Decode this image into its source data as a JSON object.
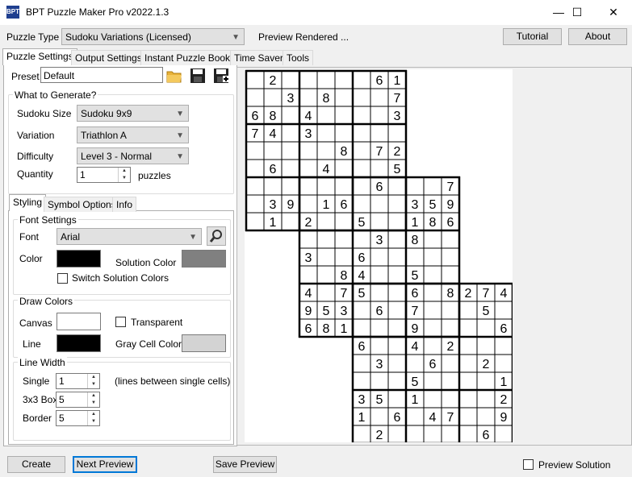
{
  "window": {
    "title": "BPT Puzzle Maker Pro v2022.1.3",
    "app_icon_text": "BPT",
    "minimize": "—",
    "maximize": "☐",
    "close": "✕"
  },
  "toolbar": {
    "puzzle_type_label": "Puzzle Type",
    "puzzle_type_value": "Sudoku Variations (Licensed)",
    "status": "Preview Rendered ...",
    "tutorial_button": "Tutorial",
    "about_button": "About"
  },
  "tabs": [
    "Puzzle Settings",
    "Output Settings",
    "Instant Puzzle Books",
    "Time Saver",
    "Tools"
  ],
  "preset": {
    "label": "Preset",
    "value": "Default"
  },
  "generate": {
    "title": "What to Generate?",
    "size_label": "Sudoku Size",
    "size_value": "Sudoku  9x9",
    "variation_label": "Variation",
    "variation_value": "Triathlon A",
    "difficulty_label": "Difficulty",
    "difficulty_value": "Level 3 - Normal",
    "quantity_label": "Quantity",
    "quantity_value": "1",
    "quantity_unit": "puzzles"
  },
  "subtabs": [
    "Styling",
    "Symbol Options",
    "Info"
  ],
  "font_settings": {
    "title": "Font Settings",
    "font_label": "Font",
    "font_value": "Arial",
    "color_label": "Color",
    "color": "#000000",
    "solution_color_label": "Solution Color",
    "solution_color": "#808080",
    "switch_label": "Switch Solution Colors"
  },
  "draw_colors": {
    "title": "Draw Colors",
    "canvas_label": "Canvas",
    "canvas_color": "#ffffff",
    "transparent_label": "Transparent",
    "line_label": "Line",
    "line_color": "#000000",
    "gray_label": "Gray Cell Color",
    "gray_color": "#d3d3d3"
  },
  "line_width": {
    "title": "Line Width",
    "single_label": "Single",
    "single_value": "1",
    "single_note": "(lines between single cells)",
    "box_label": "3x3 Box",
    "box_value": "5",
    "border_label": "Border",
    "border_value": "5"
  },
  "bottom": {
    "create": "Create",
    "next_preview": "Next Preview",
    "save_preview": "Save Preview",
    "preview_solution": "Preview Solution"
  },
  "puzzle": {
    "grids": [
      {
        "row": 0,
        "col": 0,
        "givens": [
          [
            "",
            "2",
            "",
            "",
            "",
            "",
            "",
            "6",
            "1"
          ],
          [
            "",
            "",
            "3",
            "",
            "8",
            "",
            "",
            "",
            "7"
          ],
          [
            "6",
            "8",
            "",
            "4",
            "",
            "",
            "",
            "",
            "3"
          ],
          [
            "7",
            "4",
            "",
            "3",
            "",
            "",
            "",
            "",
            ""
          ],
          [
            "",
            "",
            "",
            "",
            "",
            "8",
            "",
            "7",
            "2"
          ],
          [
            "",
            "6",
            "",
            "",
            "4",
            "",
            "",
            "",
            "5"
          ],
          [
            "",
            "",
            "",
            "",
            "",
            "",
            "",
            "6",
            ""
          ],
          [
            "",
            "3",
            "9",
            "",
            "1",
            "6",
            "",
            "",
            ""
          ],
          [
            "",
            "1",
            "",
            "2",
            "",
            "",
            "5",
            "",
            ""
          ]
        ]
      },
      {
        "row": 6,
        "col": 3,
        "givens": [
          [
            "",
            "",
            "",
            "",
            "",
            "",
            "",
            "",
            "7"
          ],
          [
            "",
            "",
            "",
            "",
            "",
            "",
            "3",
            "5",
            "9"
          ],
          [
            "",
            "",
            "",
            "",
            "",
            "",
            "1",
            "8",
            "6"
          ],
          [
            "",
            "",
            "",
            "",
            "3",
            "",
            "8",
            "",
            ""
          ],
          [
            "3",
            "",
            "",
            "6",
            "",
            "",
            "",
            "",
            ""
          ],
          [
            "",
            "",
            "8",
            "4",
            "",
            "",
            "5",
            "",
            ""
          ],
          [
            "4",
            "",
            "7",
            "5",
            "",
            "",
            "6",
            "",
            "8"
          ],
          [
            "9",
            "5",
            "3",
            "",
            "6",
            "",
            "7",
            "",
            ""
          ],
          [
            "6",
            "8",
            "1",
            "",
            "",
            "",
            "9",
            "",
            ""
          ]
        ]
      },
      {
        "row": 12,
        "col": 6,
        "givens": [
          [
            "",
            "",
            "",
            "",
            "",
            "",
            "2",
            "7",
            "4"
          ],
          [
            "",
            "",
            "",
            "",
            "",
            "",
            "",
            "5",
            ""
          ],
          [
            "",
            "",
            "",
            "",
            "",
            "",
            "",
            "",
            "6"
          ],
          [
            "6",
            "",
            "",
            "4",
            "",
            "2",
            "",
            "",
            ""
          ],
          [
            "",
            "3",
            "",
            "",
            "6",
            "",
            "",
            "2",
            ""
          ],
          [
            "",
            "",
            "",
            "5",
            "",
            "",
            "",
            "",
            "1"
          ],
          [
            "3",
            "5",
            "",
            "1",
            "",
            "",
            "",
            "",
            "2"
          ],
          [
            "1",
            "",
            "6",
            "",
            "4",
            "7",
            "",
            "",
            "9"
          ],
          [
            "",
            "2",
            "",
            "",
            "",
            "",
            "",
            "6",
            ""
          ]
        ]
      }
    ]
  }
}
